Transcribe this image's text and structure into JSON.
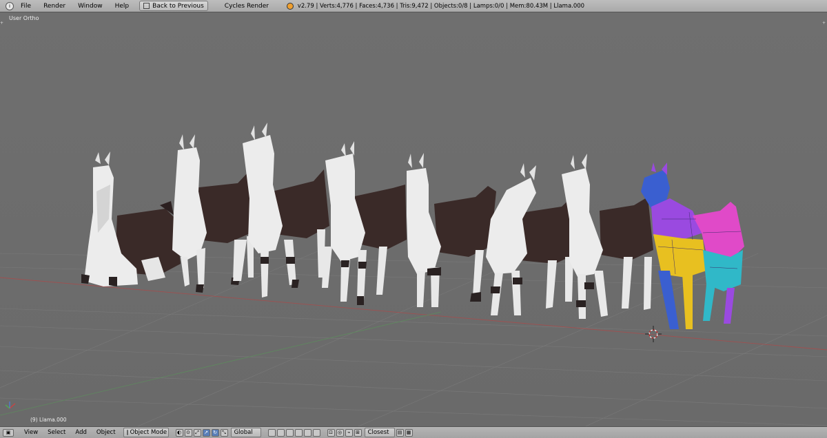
{
  "top": {
    "menus": [
      "File",
      "Render",
      "Window",
      "Help"
    ],
    "back_button": "Back to Previous",
    "render_engine": "Cycles Render",
    "stats": "v2.79 | Verts:4,776 | Faces:4,736 | Tris:9,472 | Objects:0/8 | Lamps:0/0 | Mem:80.43M | Llama.000"
  },
  "viewport": {
    "view_name": "User Ortho",
    "active_object": "(9) Llama.000"
  },
  "bottom": {
    "menus": [
      "View",
      "Select",
      "Add",
      "Object"
    ],
    "mode": "Object Mode",
    "orientation": "Global",
    "snap_target": "Closest"
  },
  "colors": {
    "viewport_bg": "#6d6d6d",
    "llama_white": "#ececec",
    "llama_brown": "#3a2a28",
    "uv_blue": "#3a5fd0",
    "uv_purple": "#9a4ae0",
    "uv_magenta": "#e04ac8",
    "uv_yellow": "#e8c020",
    "uv_teal": "#30b8c8"
  }
}
